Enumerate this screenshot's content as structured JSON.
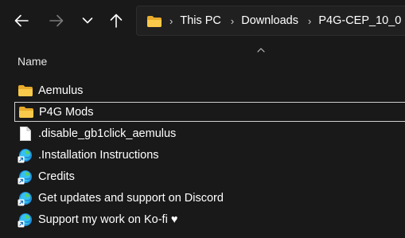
{
  "toolbar": {
    "back_icon": "arrow-left-icon",
    "forward_icon": "arrow-right-icon",
    "recent_icon": "chevron-down-icon",
    "up_icon": "arrow-up-icon"
  },
  "address_bar": {
    "folder_icon": "folder-icon",
    "breadcrumbs": [
      "This PC",
      "Downloads",
      "P4G-CEP_10_0"
    ]
  },
  "column_header": {
    "name_label": "Name"
  },
  "files": [
    {
      "name": "Aemulus",
      "type": "folder",
      "focused": false
    },
    {
      "name": "P4G Mods",
      "type": "folder",
      "focused": true
    },
    {
      "name": ".disable_gb1click_aemulus",
      "type": "file",
      "focused": false
    },
    {
      "name": ".Installation Instructions",
      "type": "edge-shortcut",
      "focused": false
    },
    {
      "name": "Credits",
      "type": "edge-shortcut",
      "focused": false
    },
    {
      "name": "Get updates and support on Discord",
      "type": "edge-shortcut",
      "focused": false
    },
    {
      "name": "Support my work on Ko-fi ♥",
      "type": "edge-shortcut",
      "focused": false
    }
  ],
  "colors": {
    "background": "#191919",
    "folder": "#f8c94a",
    "text": "#ffffff"
  }
}
